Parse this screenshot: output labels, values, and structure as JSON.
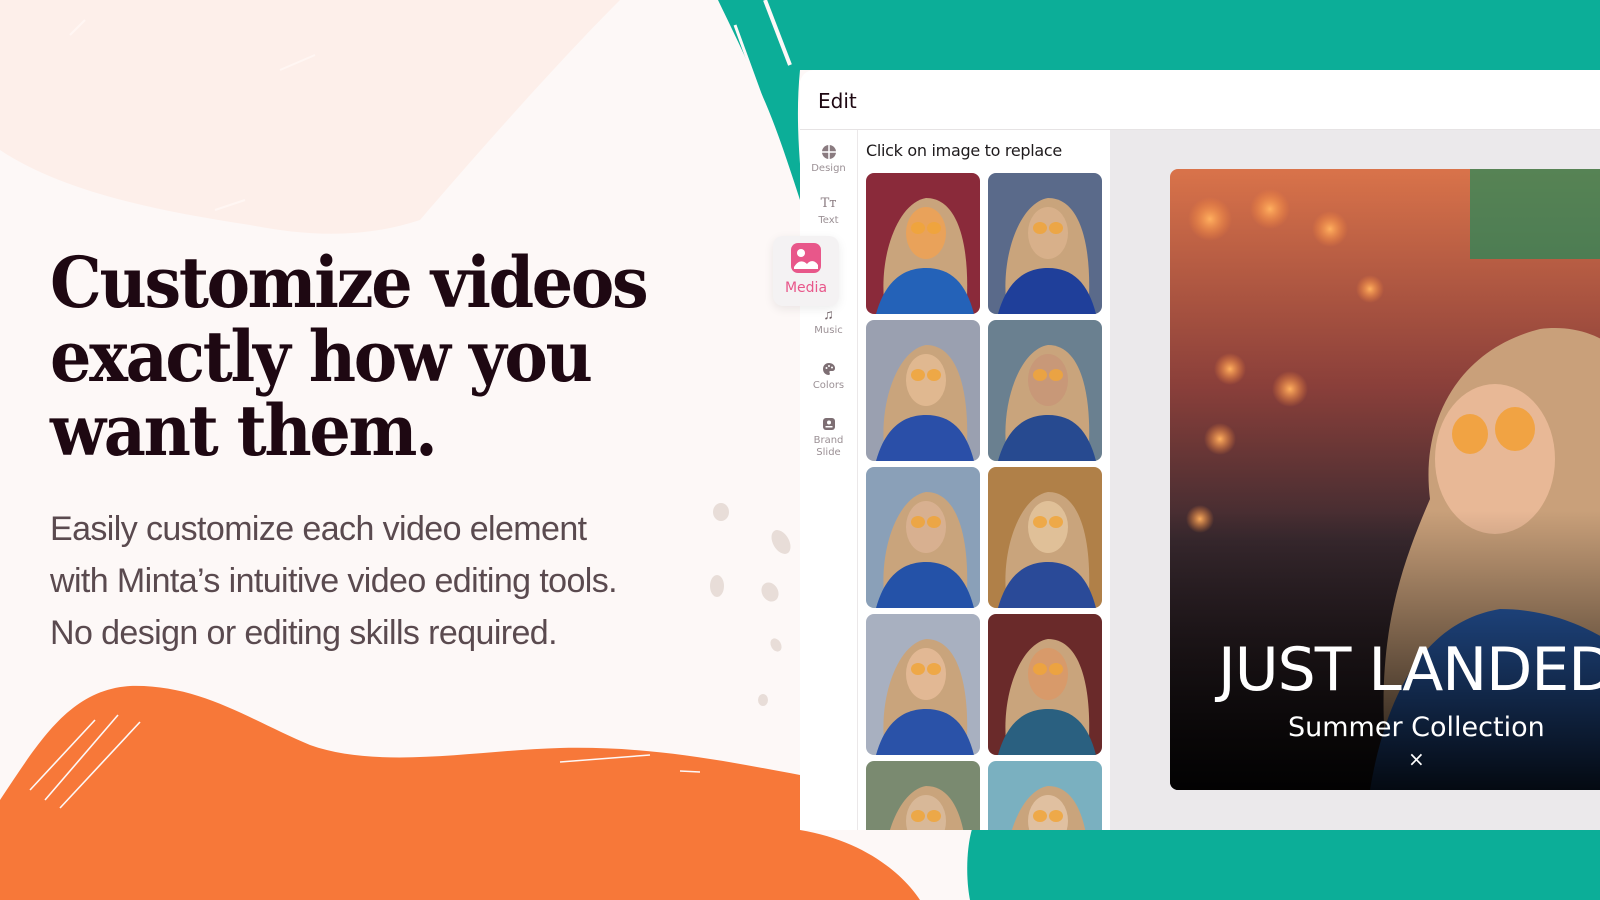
{
  "colors": {
    "teal": "#0cae98",
    "orange": "#f77839",
    "beige_blob": "#fdefea",
    "page_bg": "#fdf8f7",
    "heading": "#1e0812",
    "body_text": "#5a4a4f",
    "media_pink": "#e8578a",
    "speckle": "#e8ddd8"
  },
  "hero": {
    "heading_lines": [
      "Customize videos",
      "exactly how you",
      "want them."
    ],
    "subtext_lines": [
      "Easily customize each video element",
      "with Minta’s intuitive video editing tools.",
      "No design or editing skills required."
    ]
  },
  "editor": {
    "title": "Edit",
    "sidebar": [
      {
        "label": "Design",
        "icon": "layout-icon"
      },
      {
        "label": "Text",
        "icon": "text-icon",
        "glyph": "Tᴛ"
      },
      {
        "label": "Media",
        "icon": "image-icon",
        "active": true
      },
      {
        "label": "Music",
        "icon": "music-note-icon",
        "glyph": "♫"
      },
      {
        "label": "Colors",
        "icon": "palette-icon"
      },
      {
        "label": "Brand",
        "label2": "Slide",
        "icon": "brand-slide-icon"
      }
    ],
    "images_hint": "Click on image to replace",
    "thumbnails": [
      {
        "name": "thumb-1"
      },
      {
        "name": "thumb-2"
      },
      {
        "name": "thumb-3"
      },
      {
        "name": "thumb-4"
      },
      {
        "name": "thumb-5"
      },
      {
        "name": "thumb-6"
      },
      {
        "name": "thumb-7"
      },
      {
        "name": "thumb-8"
      },
      {
        "name": "thumb-9"
      },
      {
        "name": "thumb-10"
      }
    ],
    "preview": {
      "title": "JUST LANDED",
      "subtitle": "Summer Collection",
      "close_glyph": "×"
    }
  }
}
